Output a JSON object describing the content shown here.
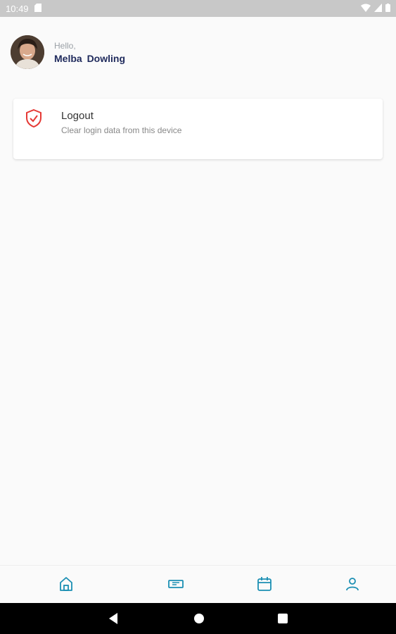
{
  "status_bar": {
    "time": "10:49"
  },
  "header": {
    "greeting": "Hello,",
    "user_name": "Melba  Dowling"
  },
  "settings": [
    {
      "title": "Logout",
      "subtitle": "Clear login data from this device",
      "icon": "shield-check-icon",
      "icon_color": "#e53935"
    }
  ],
  "bottom_nav": {
    "items": [
      {
        "icon": "home-icon"
      },
      {
        "icon": "ticket-icon"
      },
      {
        "icon": "calendar-icon"
      },
      {
        "icon": "profile-icon"
      }
    ],
    "accent_color": "#1b8fb3"
  },
  "system_nav": {
    "buttons": [
      "back-icon",
      "home-circle-icon",
      "recents-icon"
    ]
  }
}
